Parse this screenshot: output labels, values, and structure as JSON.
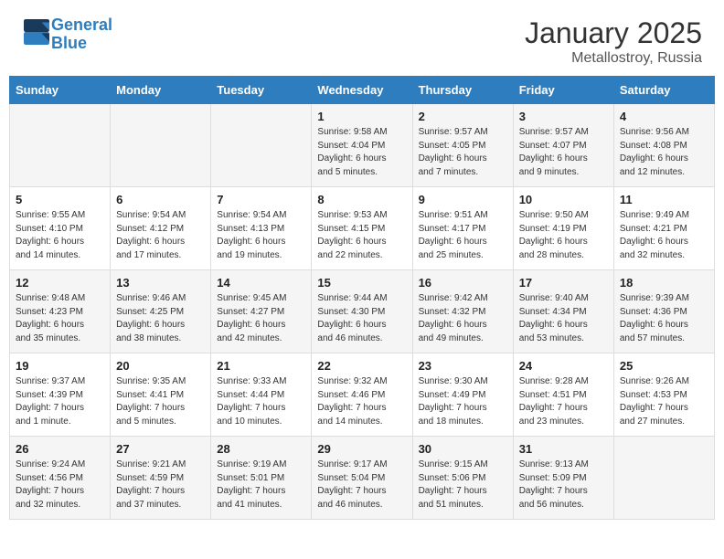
{
  "header": {
    "logo_text1": "General",
    "logo_text2": "Blue",
    "month": "January 2025",
    "location": "Metallostroy, Russia"
  },
  "weekdays": [
    "Sunday",
    "Monday",
    "Tuesday",
    "Wednesday",
    "Thursday",
    "Friday",
    "Saturday"
  ],
  "weeks": [
    [
      {
        "day": "",
        "info": ""
      },
      {
        "day": "",
        "info": ""
      },
      {
        "day": "",
        "info": ""
      },
      {
        "day": "1",
        "info": "Sunrise: 9:58 AM\nSunset: 4:04 PM\nDaylight: 6 hours\nand 5 minutes."
      },
      {
        "day": "2",
        "info": "Sunrise: 9:57 AM\nSunset: 4:05 PM\nDaylight: 6 hours\nand 7 minutes."
      },
      {
        "day": "3",
        "info": "Sunrise: 9:57 AM\nSunset: 4:07 PM\nDaylight: 6 hours\nand 9 minutes."
      },
      {
        "day": "4",
        "info": "Sunrise: 9:56 AM\nSunset: 4:08 PM\nDaylight: 6 hours\nand 12 minutes."
      }
    ],
    [
      {
        "day": "5",
        "info": "Sunrise: 9:55 AM\nSunset: 4:10 PM\nDaylight: 6 hours\nand 14 minutes."
      },
      {
        "day": "6",
        "info": "Sunrise: 9:54 AM\nSunset: 4:12 PM\nDaylight: 6 hours\nand 17 minutes."
      },
      {
        "day": "7",
        "info": "Sunrise: 9:54 AM\nSunset: 4:13 PM\nDaylight: 6 hours\nand 19 minutes."
      },
      {
        "day": "8",
        "info": "Sunrise: 9:53 AM\nSunset: 4:15 PM\nDaylight: 6 hours\nand 22 minutes."
      },
      {
        "day": "9",
        "info": "Sunrise: 9:51 AM\nSunset: 4:17 PM\nDaylight: 6 hours\nand 25 minutes."
      },
      {
        "day": "10",
        "info": "Sunrise: 9:50 AM\nSunset: 4:19 PM\nDaylight: 6 hours\nand 28 minutes."
      },
      {
        "day": "11",
        "info": "Sunrise: 9:49 AM\nSunset: 4:21 PM\nDaylight: 6 hours\nand 32 minutes."
      }
    ],
    [
      {
        "day": "12",
        "info": "Sunrise: 9:48 AM\nSunset: 4:23 PM\nDaylight: 6 hours\nand 35 minutes."
      },
      {
        "day": "13",
        "info": "Sunrise: 9:46 AM\nSunset: 4:25 PM\nDaylight: 6 hours\nand 38 minutes."
      },
      {
        "day": "14",
        "info": "Sunrise: 9:45 AM\nSunset: 4:27 PM\nDaylight: 6 hours\nand 42 minutes."
      },
      {
        "day": "15",
        "info": "Sunrise: 9:44 AM\nSunset: 4:30 PM\nDaylight: 6 hours\nand 46 minutes."
      },
      {
        "day": "16",
        "info": "Sunrise: 9:42 AM\nSunset: 4:32 PM\nDaylight: 6 hours\nand 49 minutes."
      },
      {
        "day": "17",
        "info": "Sunrise: 9:40 AM\nSunset: 4:34 PM\nDaylight: 6 hours\nand 53 minutes."
      },
      {
        "day": "18",
        "info": "Sunrise: 9:39 AM\nSunset: 4:36 PM\nDaylight: 6 hours\nand 57 minutes."
      }
    ],
    [
      {
        "day": "19",
        "info": "Sunrise: 9:37 AM\nSunset: 4:39 PM\nDaylight: 7 hours\nand 1 minute."
      },
      {
        "day": "20",
        "info": "Sunrise: 9:35 AM\nSunset: 4:41 PM\nDaylight: 7 hours\nand 5 minutes."
      },
      {
        "day": "21",
        "info": "Sunrise: 9:33 AM\nSunset: 4:44 PM\nDaylight: 7 hours\nand 10 minutes."
      },
      {
        "day": "22",
        "info": "Sunrise: 9:32 AM\nSunset: 4:46 PM\nDaylight: 7 hours\nand 14 minutes."
      },
      {
        "day": "23",
        "info": "Sunrise: 9:30 AM\nSunset: 4:49 PM\nDaylight: 7 hours\nand 18 minutes."
      },
      {
        "day": "24",
        "info": "Sunrise: 9:28 AM\nSunset: 4:51 PM\nDaylight: 7 hours\nand 23 minutes."
      },
      {
        "day": "25",
        "info": "Sunrise: 9:26 AM\nSunset: 4:53 PM\nDaylight: 7 hours\nand 27 minutes."
      }
    ],
    [
      {
        "day": "26",
        "info": "Sunrise: 9:24 AM\nSunset: 4:56 PM\nDaylight: 7 hours\nand 32 minutes."
      },
      {
        "day": "27",
        "info": "Sunrise: 9:21 AM\nSunset: 4:59 PM\nDaylight: 7 hours\nand 37 minutes."
      },
      {
        "day": "28",
        "info": "Sunrise: 9:19 AM\nSunset: 5:01 PM\nDaylight: 7 hours\nand 41 minutes."
      },
      {
        "day": "29",
        "info": "Sunrise: 9:17 AM\nSunset: 5:04 PM\nDaylight: 7 hours\nand 46 minutes."
      },
      {
        "day": "30",
        "info": "Sunrise: 9:15 AM\nSunset: 5:06 PM\nDaylight: 7 hours\nand 51 minutes."
      },
      {
        "day": "31",
        "info": "Sunrise: 9:13 AM\nSunset: 5:09 PM\nDaylight: 7 hours\nand 56 minutes."
      },
      {
        "day": "",
        "info": ""
      }
    ]
  ]
}
